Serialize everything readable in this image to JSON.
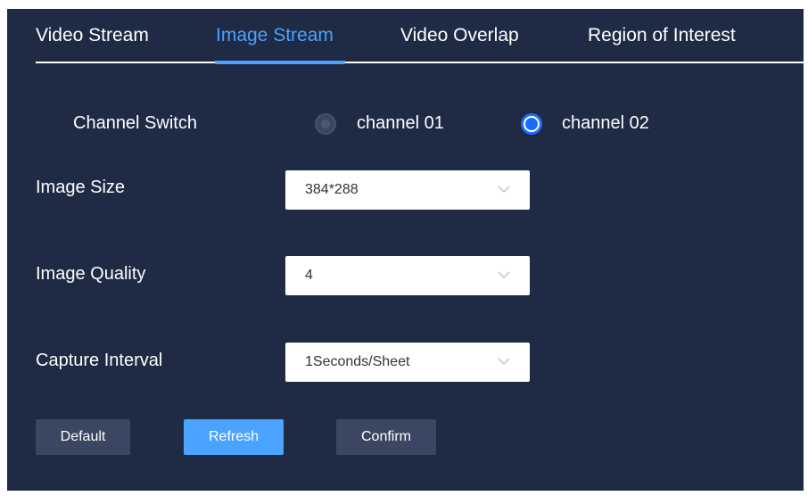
{
  "tabs": [
    {
      "label": "Video Stream",
      "active": false
    },
    {
      "label": "Image Stream",
      "active": true
    },
    {
      "label": "Video Overlap",
      "active": false
    },
    {
      "label": "Region of Interest",
      "active": false
    }
  ],
  "channel_switch": {
    "label": "Channel Switch",
    "options": [
      {
        "label": "channel 01",
        "selected": false
      },
      {
        "label": "channel 02",
        "selected": true
      }
    ]
  },
  "image_size": {
    "label": "Image Size",
    "value": "384*288"
  },
  "image_quality": {
    "label": "Image Quality",
    "value": "4"
  },
  "capture_interval": {
    "label": "Capture Interval",
    "value": "1Seconds/Sheet"
  },
  "buttons": {
    "default": "Default",
    "refresh": "Refresh",
    "confirm": "Confirm"
  },
  "colors": {
    "panel_bg": "#1f2a44",
    "accent": "#4aa3ff",
    "radio_selected": "#1e6cff",
    "button_gray": "#3b4662"
  }
}
